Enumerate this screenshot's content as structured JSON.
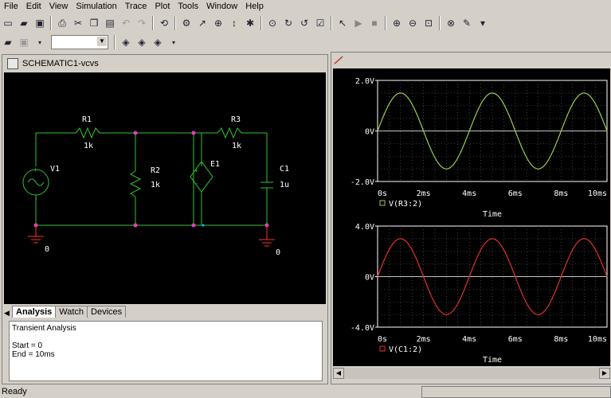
{
  "menu": [
    "File",
    "Edit",
    "View",
    "Simulation",
    "Trace",
    "Plot",
    "Tools",
    "Window",
    "Help"
  ],
  "toolbar": {
    "row1_icons": [
      "new-icon",
      "open-icon",
      "save-icon",
      "print-icon",
      "cut-icon",
      "copy-icon",
      "paste-icon",
      "undo-icon",
      "redo-icon",
      "refresh-icon",
      "probe-icon",
      "voltage-probe-icon",
      "current-probe-icon",
      "power-icon",
      "marker-icon",
      "add-trace-icon",
      "cursor-icon",
      "run-icon",
      "stop-icon",
      "zoom-in-icon",
      "zoom-out-icon",
      "zoom-fit-icon",
      "zoom-area-icon",
      "markers-icon"
    ],
    "row2_icons": [
      "open-profile-icon",
      "edit-profile-icon",
      "diamond-icon-1",
      "diamond-icon-2",
      "diamond-icon-3"
    ],
    "profile_select": ""
  },
  "schematic": {
    "title": "SCHEMATIC1-vcvs",
    "components": {
      "R1": {
        "name": "R1",
        "value": "1k"
      },
      "R2": {
        "name": "R2",
        "value": "1k"
      },
      "R3": {
        "name": "R3",
        "value": "1k"
      },
      "V1": {
        "name": "V1"
      },
      "E1": {
        "name": "E1"
      },
      "C1": {
        "name": "C1",
        "value": "1u"
      }
    },
    "ground1": "0",
    "ground2": "0",
    "colors": {
      "wire": "#2fc42f",
      "node": "#e040c0",
      "resistor": "#2fc42f",
      "ground": "#ff3030",
      "label": "#ffffff",
      "source": "#2fc42f"
    }
  },
  "tabs": [
    "Analysis",
    "Watch",
    "Devices"
  ],
  "output": {
    "line1": "Transient Analysis",
    "line2": "Start = 0",
    "line3": "End = 10ms"
  },
  "chart_data": [
    {
      "type": "line",
      "title": "",
      "xlabel": "Time",
      "ylabel": "",
      "x_ticks": [
        "0s",
        "2ms",
        "4ms",
        "6ms",
        "8ms",
        "10ms"
      ],
      "y_ticks": [
        "2.0V",
        "0V",
        "-2.0V"
      ],
      "xlim": [
        0,
        10
      ],
      "ylim": [
        -2,
        2
      ],
      "legend": "V(R3:2)",
      "color": "#9acd50",
      "series": [
        {
          "name": "V(R3:2)",
          "amplitude": 1.5,
          "period_ms": 4.0
        }
      ]
    },
    {
      "type": "line",
      "title": "",
      "xlabel": "Time",
      "ylabel": "",
      "x_ticks": [
        "0s",
        "2ms",
        "4ms",
        "6ms",
        "8ms",
        "10ms"
      ],
      "y_ticks": [
        "4.0V",
        "0V",
        "-4.0V"
      ],
      "xlim": [
        0,
        10
      ],
      "ylim": [
        -4,
        4
      ],
      "legend": "V(C1:2)",
      "color": "#e03030",
      "series": [
        {
          "name": "V(C1:2)",
          "amplitude": 3.0,
          "period_ms": 4.0
        }
      ]
    }
  ],
  "status": "Ready"
}
